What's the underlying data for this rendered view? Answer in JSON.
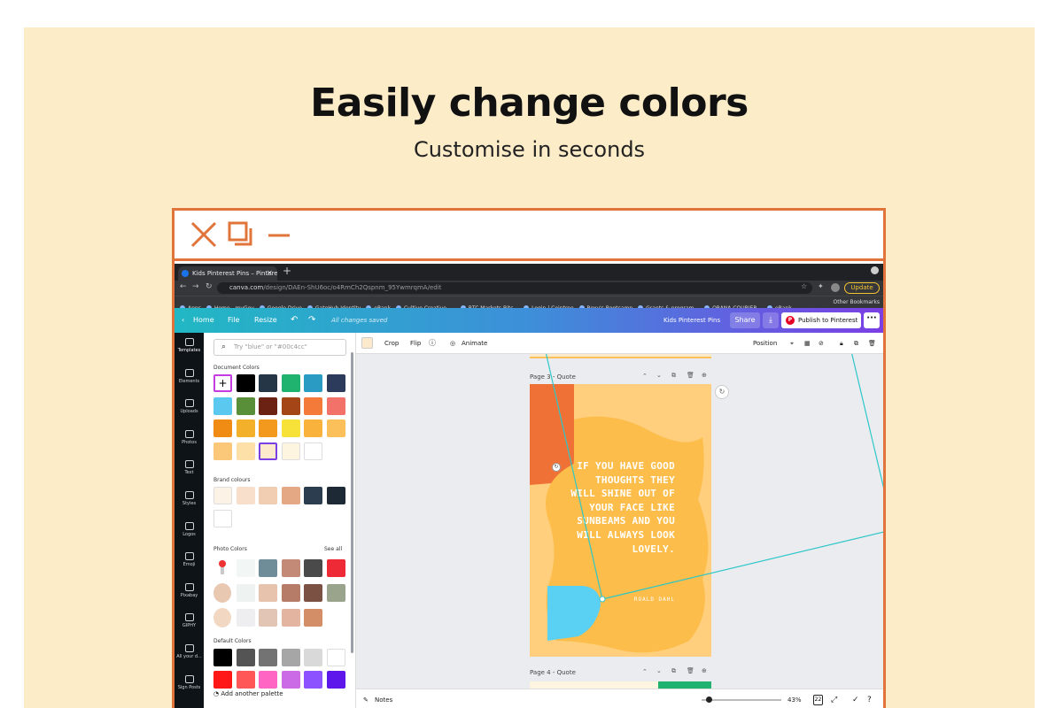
{
  "hero": {
    "title": "Easily change colors",
    "subtitle": "Customise in seconds"
  },
  "frame_icons": [
    "close-icon",
    "copy-icon",
    "minimize-icon"
  ],
  "browser": {
    "tab_title": "Kids Pinterest Pins – Pinterest",
    "url_host": "canva.com",
    "url_path": "/design/DAEn-ShU6oc/o4RmCh2Qspnm_95YwmrqmA/edit",
    "update_label": "Update",
    "bookmarks": [
      "Apps",
      "Home - myGov",
      "Google Drive",
      "GateHub Identity",
      "eRank",
      "Cultive Creative -...",
      "BTC Markets Bitc...",
      "Login | Cointree",
      "Roxy's Bootcamp",
      "Grants & program...",
      "ORANA COURIER...",
      "eRank"
    ],
    "other_bookmarks": "Other Bookmarks"
  },
  "canva_header": {
    "home": "Home",
    "file": "File",
    "resize": "Resize",
    "saved": "All changes saved",
    "design_name": "Kids Pinterest Pins",
    "share": "Share",
    "publish": "Publish to Pinterest"
  },
  "sidebar": [
    "Templates",
    "Elements",
    "Uploads",
    "Photos",
    "Text",
    "Styles",
    "Logos",
    "Emoji",
    "Pixabay",
    "GIPHY",
    "All your d...",
    "Sign Posts"
  ],
  "color_panel": {
    "search_placeholder": "Try \"blue\" or \"#00c4cc\"",
    "document_colors_label": "Document Colors",
    "document_colors": [
      "#000000",
      "#253746",
      "#1fb36f",
      "#2a9cc4",
      "#2c3a5c",
      "#5bc8f0",
      "#5a8f3a",
      "#6b2212",
      "#a34516",
      "#f47a3a",
      "#f2726a",
      "#f08c14",
      "#f3b12b",
      "#f39a1e",
      "#f7e23a",
      "#f9b33d",
      "#fcc05a",
      "#fbc879",
      "#fde0a8",
      "#fde9cc",
      "#fef5e0",
      "#ffffff"
    ],
    "brand_colours_label": "Brand colours",
    "brand_colours": [
      "#fdf2e6",
      "#f8dfcc",
      "#f1cdb2",
      "#e5a884",
      "#2b3d4f",
      "#1d2a36",
      "#ffffff"
    ],
    "photo_colors_label": "Photo Colors",
    "see_all": "See all",
    "photo_colors": [
      [
        "#f2f6f5",
        "#6e8d99",
        "#c48a78",
        "#4a4a4a",
        "#ee2a36"
      ],
      [
        "#eef3f1",
        "#e7c2ad",
        "#b67c68",
        "#7a5143",
        "#9aa48d"
      ],
      [
        "#eeeef0",
        "#e3c5b5",
        "#e3b49f",
        "#d38d67"
      ]
    ],
    "default_colors_label": "Default Colors",
    "default_colors": [
      "#000000",
      "#545454",
      "#737373",
      "#a6a6a6",
      "#d9d9d9",
      "#ffffff"
    ],
    "default_colors_row2": [
      "#ff1616",
      "#ff5757",
      "#ff66c4",
      "#cb6ce6",
      "#8c52ff",
      "#5e17eb"
    ],
    "add_palette": "Add another palette"
  },
  "toolbar": {
    "crop": "Crop",
    "flip": "Flip",
    "animate": "Animate",
    "position": "Position"
  },
  "canvas": {
    "page3_label": "Page 3 - Quote",
    "page4_label": "Page 4 - Quote",
    "quote": "IF YOU HAVE GOOD THOUGHTS THEY WILL SHINE OUT OF YOUR FACE LIKE SUNBEAMS AND YOU WILL ALWAYS LOOK LOVELY.",
    "author": "ROALD DAHL"
  },
  "footer": {
    "notes": "Notes",
    "zoom": "43%",
    "zoom_fraction": 0.06,
    "pages": "22"
  },
  "colors": {
    "accent": "#e0743a",
    "background": "#fdecc8",
    "pin_bg": "#ffcf7d",
    "pin_orange": "#f07136",
    "pin_blue": "#5ad0f2",
    "guide_line": "#2ec7c7"
  }
}
